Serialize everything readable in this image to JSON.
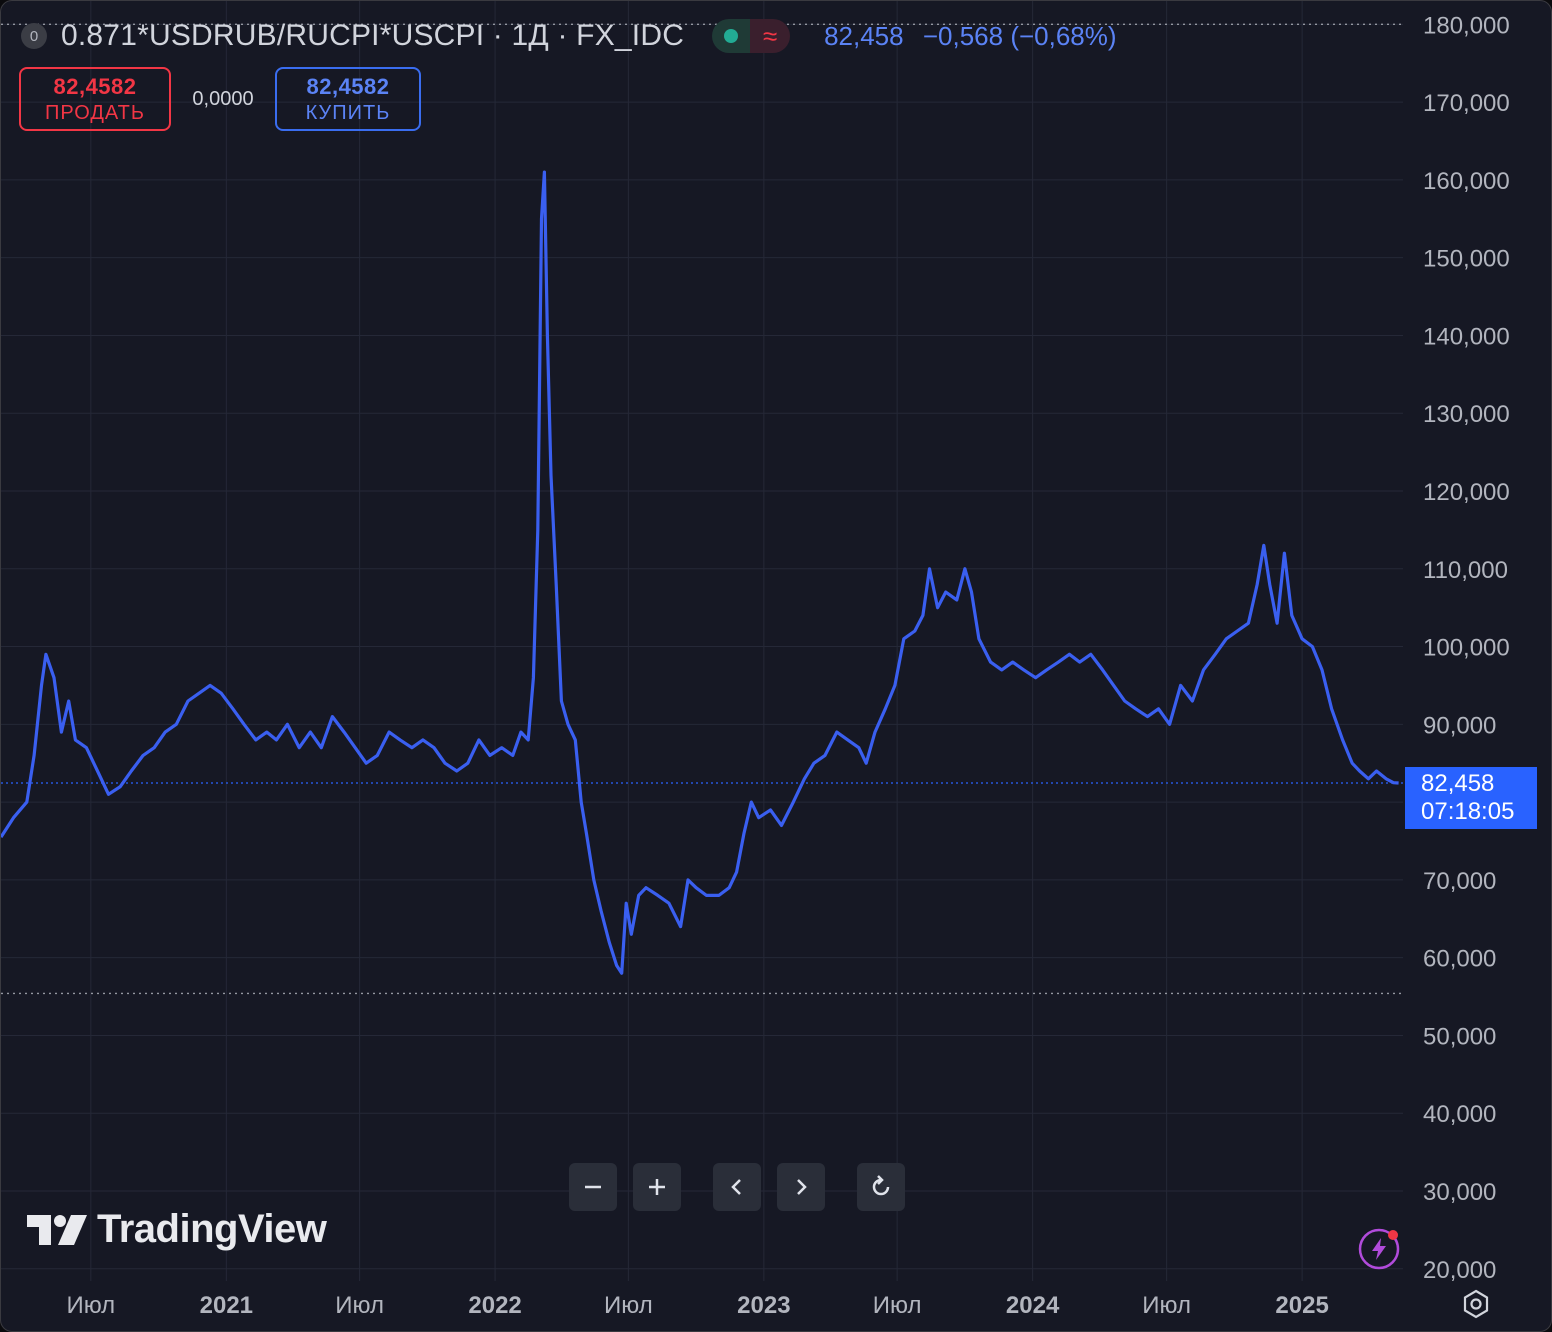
{
  "header": {
    "badge": "0",
    "symbol": "0.871*USDRUB/RUCPI*USCPI · 1Д · FX_IDC",
    "status_wave": "≈",
    "last_price": "82,458",
    "change": "−0,568 (−0,68%)"
  },
  "trade": {
    "sell_price": "82,4582",
    "sell_label": "ПРОДАТЬ",
    "spread": "0,0000",
    "buy_price": "82,4582",
    "buy_label": "КУПИТЬ"
  },
  "toolbar": {
    "zoom_out": "−",
    "zoom_in": "+",
    "scroll_left": "‹",
    "scroll_right": "›",
    "reset": "↻"
  },
  "branding": {
    "name": "TradingView"
  },
  "chart_data": {
    "type": "line",
    "title": "",
    "xlabel": "",
    "ylabel": "",
    "x_range": [
      "2020-03-01",
      "2025-05-18"
    ],
    "y_range": [
      12000,
      183000
    ],
    "y_ticks": [
      20000,
      30000,
      40000,
      50000,
      60000,
      70000,
      90000,
      100000,
      110000,
      120000,
      130000,
      140000,
      150000,
      160000,
      170000,
      180000
    ],
    "y_tick_labels": [
      "20,000",
      "30,000",
      "40,000",
      "50,000",
      "60,000",
      "70,000",
      "90,000",
      "100,000",
      "110,000",
      "120,000",
      "130,000",
      "140,000",
      "150,000",
      "160,000",
      "170,000",
      "180,000"
    ],
    "x_ticks": [
      {
        "date": "2020-07-01",
        "label": "Июл",
        "bold": false
      },
      {
        "date": "2021-01-01",
        "label": "2021",
        "bold": true
      },
      {
        "date": "2021-07-01",
        "label": "Июл",
        "bold": false
      },
      {
        "date": "2022-01-01",
        "label": "2022",
        "bold": true
      },
      {
        "date": "2022-07-01",
        "label": "Июл",
        "bold": false
      },
      {
        "date": "2023-01-01",
        "label": "2023",
        "bold": true
      },
      {
        "date": "2023-07-01",
        "label": "Июл",
        "bold": false
      },
      {
        "date": "2024-01-01",
        "label": "2024",
        "bold": true
      },
      {
        "date": "2024-07-01",
        "label": "Июл",
        "bold": false
      },
      {
        "date": "2025-01-01",
        "label": "2025",
        "bold": true
      }
    ],
    "reference_lines": [
      180000,
      55400
    ],
    "last_value": 82458,
    "last_value_label": "82,458",
    "countdown": "07:18:05",
    "grid": true,
    "series": [
      {
        "color": "#3a5ff0",
        "points": [
          [
            "2020-03-01",
            75500
          ],
          [
            "2020-03-18",
            78000
          ],
          [
            "2020-04-05",
            80000
          ],
          [
            "2020-04-15",
            86000
          ],
          [
            "2020-04-25",
            95000
          ],
          [
            "2020-05-01",
            99000
          ],
          [
            "2020-05-12",
            96000
          ],
          [
            "2020-05-22",
            89000
          ],
          [
            "2020-06-01",
            93000
          ],
          [
            "2020-06-10",
            88000
          ],
          [
            "2020-06-25",
            87000
          ],
          [
            "2020-07-10",
            84000
          ],
          [
            "2020-07-25",
            81000
          ],
          [
            "2020-08-10",
            82000
          ],
          [
            "2020-08-25",
            84000
          ],
          [
            "2020-09-10",
            86000
          ],
          [
            "2020-09-25",
            87000
          ],
          [
            "2020-10-10",
            89000
          ],
          [
            "2020-10-25",
            90000
          ],
          [
            "2020-11-10",
            93000
          ],
          [
            "2020-11-25",
            94000
          ],
          [
            "2020-12-10",
            95000
          ],
          [
            "2020-12-25",
            94000
          ],
          [
            "2021-01-10",
            92000
          ],
          [
            "2021-01-25",
            90000
          ],
          [
            "2021-02-10",
            88000
          ],
          [
            "2021-02-25",
            89000
          ],
          [
            "2021-03-10",
            88000
          ],
          [
            "2021-03-25",
            90000
          ],
          [
            "2021-04-10",
            87000
          ],
          [
            "2021-04-25",
            89000
          ],
          [
            "2021-05-10",
            87000
          ],
          [
            "2021-05-25",
            91000
          ],
          [
            "2021-06-10",
            89000
          ],
          [
            "2021-06-25",
            87000
          ],
          [
            "2021-07-10",
            85000
          ],
          [
            "2021-07-25",
            86000
          ],
          [
            "2021-08-10",
            89000
          ],
          [
            "2021-08-25",
            88000
          ],
          [
            "2021-09-10",
            87000
          ],
          [
            "2021-09-25",
            88000
          ],
          [
            "2021-10-10",
            87000
          ],
          [
            "2021-10-25",
            85000
          ],
          [
            "2021-11-10",
            84000
          ],
          [
            "2021-11-25",
            85000
          ],
          [
            "2021-12-10",
            88000
          ],
          [
            "2021-12-25",
            86000
          ],
          [
            "2022-01-10",
            87000
          ],
          [
            "2022-01-25",
            86000
          ],
          [
            "2022-02-05",
            89000
          ],
          [
            "2022-02-15",
            88000
          ],
          [
            "2022-02-22",
            96000
          ],
          [
            "2022-02-28",
            115000
          ],
          [
            "2022-03-05",
            155000
          ],
          [
            "2022-03-09",
            161000
          ],
          [
            "2022-03-13",
            140000
          ],
          [
            "2022-03-18",
            122000
          ],
          [
            "2022-03-25",
            108000
          ],
          [
            "2022-04-01",
            93000
          ],
          [
            "2022-04-10",
            90000
          ],
          [
            "2022-04-20",
            88000
          ],
          [
            "2022-04-28",
            80000
          ],
          [
            "2022-05-05",
            76000
          ],
          [
            "2022-05-15",
            70000
          ],
          [
            "2022-05-25",
            66000
          ],
          [
            "2022-06-05",
            62000
          ],
          [
            "2022-06-15",
            59000
          ],
          [
            "2022-06-22",
            58000
          ],
          [
            "2022-06-28",
            67000
          ],
          [
            "2022-07-05",
            63000
          ],
          [
            "2022-07-15",
            68000
          ],
          [
            "2022-07-25",
            69000
          ],
          [
            "2022-08-10",
            68000
          ],
          [
            "2022-08-25",
            67000
          ],
          [
            "2022-09-10",
            64000
          ],
          [
            "2022-09-20",
            70000
          ],
          [
            "2022-10-01",
            69000
          ],
          [
            "2022-10-15",
            68000
          ],
          [
            "2022-11-01",
            68000
          ],
          [
            "2022-11-15",
            69000
          ],
          [
            "2022-11-25",
            71000
          ],
          [
            "2022-12-05",
            76000
          ],
          [
            "2022-12-15",
            80000
          ],
          [
            "2022-12-25",
            78000
          ],
          [
            "2023-01-10",
            79000
          ],
          [
            "2023-01-25",
            77000
          ],
          [
            "2023-02-10",
            80000
          ],
          [
            "2023-02-25",
            83000
          ],
          [
            "2023-03-10",
            85000
          ],
          [
            "2023-03-25",
            86000
          ],
          [
            "2023-04-10",
            89000
          ],
          [
            "2023-04-25",
            88000
          ],
          [
            "2023-05-10",
            87000
          ],
          [
            "2023-05-20",
            85000
          ],
          [
            "2023-06-01",
            89000
          ],
          [
            "2023-06-15",
            92000
          ],
          [
            "2023-06-28",
            95000
          ],
          [
            "2023-07-10",
            101000
          ],
          [
            "2023-07-25",
            102000
          ],
          [
            "2023-08-05",
            104000
          ],
          [
            "2023-08-14",
            110000
          ],
          [
            "2023-08-25",
            105000
          ],
          [
            "2023-09-05",
            107000
          ],
          [
            "2023-09-20",
            106000
          ],
          [
            "2023-10-01",
            110000
          ],
          [
            "2023-10-10",
            107000
          ],
          [
            "2023-10-20",
            101000
          ],
          [
            "2023-11-05",
            98000
          ],
          [
            "2023-11-20",
            97000
          ],
          [
            "2023-12-05",
            98000
          ],
          [
            "2023-12-20",
            97000
          ],
          [
            "2024-01-05",
            96000
          ],
          [
            "2024-01-20",
            97000
          ],
          [
            "2024-02-05",
            98000
          ],
          [
            "2024-02-20",
            99000
          ],
          [
            "2024-03-05",
            98000
          ],
          [
            "2024-03-20",
            99000
          ],
          [
            "2024-04-05",
            97000
          ],
          [
            "2024-04-20",
            95000
          ],
          [
            "2024-05-05",
            93000
          ],
          [
            "2024-05-20",
            92000
          ],
          [
            "2024-06-05",
            91000
          ],
          [
            "2024-06-20",
            92000
          ],
          [
            "2024-07-05",
            90000
          ],
          [
            "2024-07-20",
            95000
          ],
          [
            "2024-08-05",
            93000
          ],
          [
            "2024-08-20",
            97000
          ],
          [
            "2024-09-05",
            99000
          ],
          [
            "2024-09-20",
            101000
          ],
          [
            "2024-10-05",
            102000
          ],
          [
            "2024-10-20",
            103000
          ],
          [
            "2024-11-01",
            108000
          ],
          [
            "2024-11-10",
            113000
          ],
          [
            "2024-11-18",
            108000
          ],
          [
            "2024-11-28",
            103000
          ],
          [
            "2024-12-08",
            112000
          ],
          [
            "2024-12-18",
            104000
          ],
          [
            "2025-01-01",
            101000
          ],
          [
            "2025-01-15",
            100000
          ],
          [
            "2025-01-28",
            97000
          ],
          [
            "2025-02-10",
            92000
          ],
          [
            "2025-02-25",
            88000
          ],
          [
            "2025-03-10",
            85000
          ],
          [
            "2025-03-20",
            84000
          ],
          [
            "2025-04-01",
            83000
          ],
          [
            "2025-04-12",
            84000
          ],
          [
            "2025-04-25",
            83000
          ],
          [
            "2025-05-05",
            82500
          ],
          [
            "2025-05-12",
            82458
          ]
        ]
      }
    ]
  },
  "colors": {
    "background": "#161824",
    "line": "#3a5ff0",
    "grid": "#252837",
    "axis_text": "#b2b5be",
    "price_tag": "#2962ff",
    "sell": "#f23645",
    "buy": "#5b83f5"
  }
}
